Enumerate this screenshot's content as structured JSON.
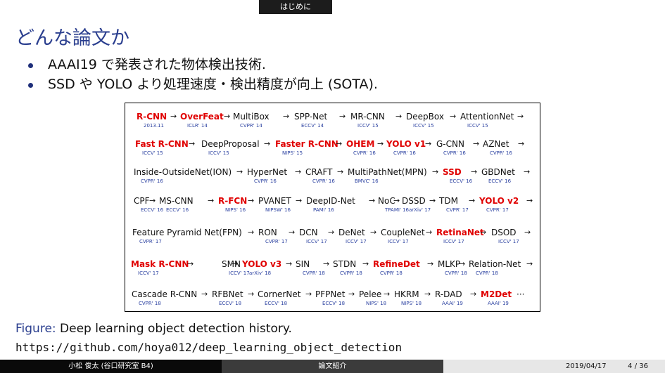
{
  "header": {
    "section": "はじめに"
  },
  "slide": {
    "title": "どんな論文か",
    "bullets": [
      "AAAI19 で発表された物体検出技術.",
      "SSD や YOLO より処理速度・検出精度が向上 (SOTA)."
    ]
  },
  "diagram": {
    "nodes": [
      {
        "id": "r1a",
        "label": "R-CNN",
        "red": true,
        "venue": "2013.11"
      },
      {
        "id": "r1b",
        "label": "OverFeat",
        "red": true,
        "venue": "ICLR' 14"
      },
      {
        "id": "r1c",
        "label": "MultiBox",
        "red": false,
        "venue": "CVPR' 14"
      },
      {
        "id": "r1d",
        "label": "SPP-Net",
        "red": false,
        "venue": "ECCV' 14"
      },
      {
        "id": "r1e",
        "label": "MR-CNN",
        "red": false,
        "venue": "ICCV' 15"
      },
      {
        "id": "r1f",
        "label": "DeepBox",
        "red": false,
        "venue": "ICCV' 15"
      },
      {
        "id": "r1g",
        "label": "AttentionNet",
        "red": false,
        "venue": "ICCV' 15"
      },
      {
        "id": "r2a",
        "label": "Fast R-CNN",
        "red": true,
        "venue": "ICCV' 15"
      },
      {
        "id": "r2b",
        "label": "DeepProposal",
        "red": false,
        "venue": "ICCV' 15"
      },
      {
        "id": "r2c",
        "label": "Faster R-CNN",
        "red": true,
        "venue": "NIPS' 15"
      },
      {
        "id": "r2d",
        "label": "OHEM",
        "red": true,
        "venue": "CVPR' 16"
      },
      {
        "id": "r2e",
        "label": "YOLO v1",
        "red": true,
        "venue": "CVPR' 16"
      },
      {
        "id": "r2f",
        "label": "G-CNN",
        "red": false,
        "venue": "CVPR' 16"
      },
      {
        "id": "r2g",
        "label": "AZNet",
        "red": false,
        "venue": "CVPR' 16"
      },
      {
        "id": "r3a",
        "label": "Inside-OutsideNet(ION)",
        "red": false,
        "venue": "CVPR' 16"
      },
      {
        "id": "r3b",
        "label": "HyperNet",
        "red": false,
        "venue": "CVPR' 16"
      },
      {
        "id": "r3c",
        "label": "CRAFT",
        "red": false,
        "venue": "CVPR' 16"
      },
      {
        "id": "r3d",
        "label": "MultiPathNet(MPN)",
        "red": false,
        "venue": "BMVC' 16"
      },
      {
        "id": "r3e",
        "label": "SSD",
        "red": true,
        "venue": "ECCV' 16"
      },
      {
        "id": "r3f",
        "label": "GBDNet",
        "red": false,
        "venue": "ECCV' 16"
      },
      {
        "id": "r4a",
        "label": "CPF",
        "red": false,
        "venue": "ECCV' 16"
      },
      {
        "id": "r4b",
        "label": "MS-CNN",
        "red": false,
        "venue": "ECCV' 16"
      },
      {
        "id": "r4c",
        "label": "R-FCN",
        "red": true,
        "venue": "NIPS' 16"
      },
      {
        "id": "r4d",
        "label": "PVANET",
        "red": false,
        "venue": "NIPSW' 16"
      },
      {
        "id": "r4e",
        "label": "DeepID-Net",
        "red": false,
        "venue": "PAMI' 16"
      },
      {
        "id": "r4f",
        "label": "NoC",
        "red": false,
        "venue": "TPAMI' 16"
      },
      {
        "id": "r4g",
        "label": "DSSD",
        "red": false,
        "venue": "arXiv' 17"
      },
      {
        "id": "r4h",
        "label": "TDM",
        "red": false,
        "venue": "CVPR' 17"
      },
      {
        "id": "r4i",
        "label": "YOLO v2",
        "red": true,
        "venue": "CVPR' 17"
      },
      {
        "id": "r5a",
        "label": "Feature Pyramid Net(FPN)",
        "red": false,
        "venue": "CVPR' 17"
      },
      {
        "id": "r5b",
        "label": "RON",
        "red": false,
        "venue": "CVPR' 17"
      },
      {
        "id": "r5c",
        "label": "DCN",
        "red": false,
        "venue": "ICCV' 17"
      },
      {
        "id": "r5d",
        "label": "DeNet",
        "red": false,
        "venue": "ICCV' 17"
      },
      {
        "id": "r5e",
        "label": "CoupleNet",
        "red": false,
        "venue": "ICCV' 17"
      },
      {
        "id": "r5f",
        "label": "RetinaNet",
        "red": true,
        "venue": "ICCV' 17"
      },
      {
        "id": "r5g",
        "label": "DSOD",
        "red": false,
        "venue": "ICCV' 17"
      },
      {
        "id": "r6a",
        "label": "Mask R-CNN",
        "red": true,
        "venue": "ICCV' 17"
      },
      {
        "id": "r6b",
        "label": "SMN",
        "red": false,
        "venue": "ICCV' 17"
      },
      {
        "id": "r6c",
        "label": "YOLO v3",
        "red": true,
        "venue": "arXiv' 18"
      },
      {
        "id": "r6d",
        "label": "SIN",
        "red": false,
        "venue": "CVPR' 18"
      },
      {
        "id": "r6e",
        "label": "STDN",
        "red": false,
        "venue": "CVPR' 18"
      },
      {
        "id": "r6f",
        "label": "RefineDet",
        "red": true,
        "venue": "CVPR' 18"
      },
      {
        "id": "r6g",
        "label": "MLKP",
        "red": false,
        "venue": "CVPR' 18"
      },
      {
        "id": "r6h",
        "label": "Relation-Net",
        "red": false,
        "venue": "CVPR' 18"
      },
      {
        "id": "r7a",
        "label": "Cascade R-CNN",
        "red": false,
        "venue": "CVPR' 18"
      },
      {
        "id": "r7b",
        "label": "RFBNet",
        "red": false,
        "venue": "ECCV' 18"
      },
      {
        "id": "r7c",
        "label": "CornerNet",
        "red": false,
        "venue": "ECCV' 18"
      },
      {
        "id": "r7d",
        "label": "PFPNet",
        "red": false,
        "venue": "ECCV' 18"
      },
      {
        "id": "r7e",
        "label": "Pelee",
        "red": false,
        "venue": "NIPS' 18"
      },
      {
        "id": "r7f",
        "label": "HKRM",
        "red": false,
        "venue": "NIPS' 18"
      },
      {
        "id": "r7g",
        "label": "R-DAD",
        "red": false,
        "venue": "AAAI' 19"
      },
      {
        "id": "r7h",
        "label": "M2Det",
        "red": true,
        "venue": "AAAI' 19"
      },
      {
        "id": "r7i",
        "label": "···",
        "red": false,
        "venue": ""
      }
    ]
  },
  "caption": {
    "label": "Figure:",
    "text": "Deep learning object detection history."
  },
  "url": "https://github.com/hoya012/deep_learning_object_detection",
  "footer": {
    "author": "小松 俊太 (谷口研究室 B4)",
    "talk": "論文紹介",
    "date": "2019/04/17",
    "page": "4 / 36"
  }
}
